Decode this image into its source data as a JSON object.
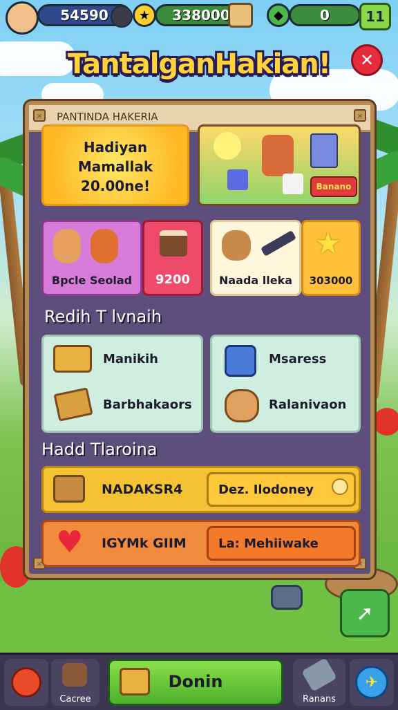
{
  "header": {
    "score": "54590",
    "coins": "338000",
    "gems": "0",
    "level": "11"
  },
  "title": "TantalganHakian!",
  "panel": {
    "heading": "PANTINDA HAKERIA",
    "banner": {
      "line1": "Hadiyan",
      "line2": "Mamallak",
      "line3": "20.00ne!"
    },
    "promo_badge": "Banano",
    "offers": [
      {
        "label": "Bpcle Seolad"
      },
      {
        "label": "9200"
      },
      {
        "label": "Naada lleka"
      },
      {
        "label": "303000"
      }
    ],
    "section1_title": "Redih T lvnaih",
    "section1_items": [
      {
        "label": "Manikih"
      },
      {
        "label": "Msaress"
      },
      {
        "label": "Barbhakaors"
      },
      {
        "label": "Ralanivaon"
      }
    ],
    "section2_title": "Hadd Tlaroina",
    "rows": [
      {
        "left": "NADAKSR4",
        "right": "Dez. Ilodoney",
        "color": "#f4c232"
      },
      {
        "left": "IGYMk GIIM",
        "right": "La: Mehiiwake",
        "color": "#f08a3c"
      }
    ]
  },
  "bottom_nav": {
    "item1": "Cacree",
    "main_button": "Donin",
    "item3": "Ranans"
  },
  "colors": {
    "panel": "#5e4e7c",
    "frame": "#b88a54",
    "title_fill": "#ffd43a",
    "green_button": "#6bc43a"
  }
}
